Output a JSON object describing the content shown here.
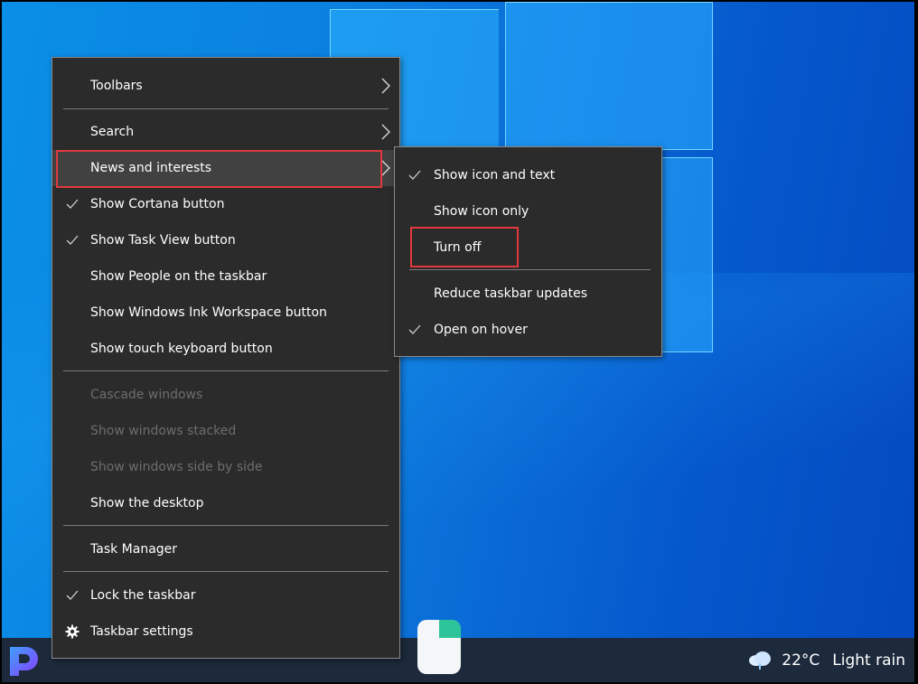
{
  "context_menu": {
    "items": [
      {
        "label": "Toolbars",
        "checked": false,
        "disabled": false,
        "submenu": true
      },
      {
        "label": "Search",
        "checked": false,
        "disabled": false,
        "submenu": true
      },
      {
        "label": "News and interests",
        "checked": false,
        "disabled": false,
        "submenu": true,
        "highlighted": true
      },
      {
        "label": "Show Cortana button",
        "checked": true,
        "disabled": false
      },
      {
        "label": "Show Task View button",
        "checked": true,
        "disabled": false
      },
      {
        "label": "Show People on the taskbar",
        "checked": false,
        "disabled": false
      },
      {
        "label": "Show Windows Ink Workspace button",
        "checked": false,
        "disabled": false
      },
      {
        "label": "Show touch keyboard button",
        "checked": false,
        "disabled": false
      },
      {
        "label": "Cascade windows",
        "checked": false,
        "disabled": true
      },
      {
        "label": "Show windows stacked",
        "checked": false,
        "disabled": true
      },
      {
        "label": "Show windows side by side",
        "checked": false,
        "disabled": true
      },
      {
        "label": "Show the desktop",
        "checked": false,
        "disabled": false
      },
      {
        "label": "Task Manager",
        "checked": false,
        "disabled": false
      },
      {
        "label": "Lock the taskbar",
        "checked": true,
        "disabled": false
      },
      {
        "label": "Taskbar settings",
        "icon": "gear-icon",
        "disabled": false
      }
    ]
  },
  "news_submenu": {
    "items": [
      {
        "label": "Show icon and text",
        "checked": true
      },
      {
        "label": "Show icon only",
        "checked": false
      },
      {
        "label": "Turn off",
        "checked": false,
        "annotated": true
      },
      {
        "label": "Reduce taskbar updates",
        "checked": false
      },
      {
        "label": "Open on hover",
        "checked": true
      }
    ]
  },
  "taskbar": {
    "app_logo": "P",
    "weather": {
      "icon": "cloud-rain-icon",
      "temperature": "22°C",
      "condition": "Light rain"
    }
  },
  "colors": {
    "menu_background": "#2b2b2b",
    "annotation_red": "#e0393e",
    "taskbar": "#1c2a3b",
    "desktop_blue": "#0a6cd6"
  }
}
